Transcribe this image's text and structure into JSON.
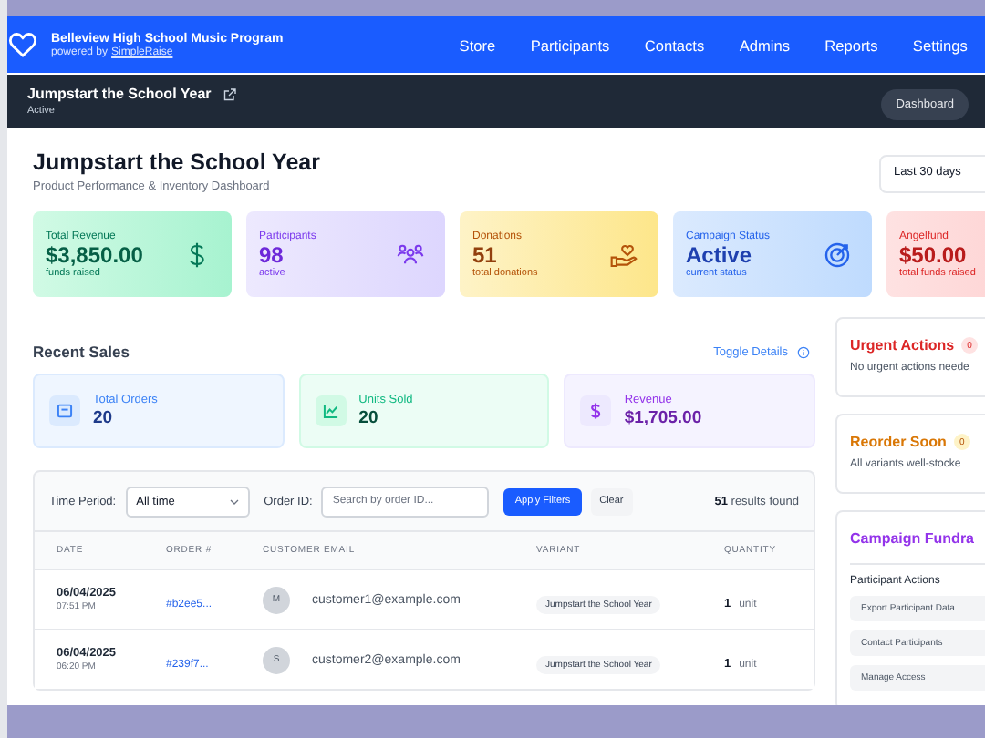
{
  "header": {
    "org": "Belleview High School Music Program",
    "powered_by": "powered by",
    "brand_link": "SimpleRaise",
    "nav": [
      "Store",
      "Participants",
      "Contacts",
      "Admins",
      "Reports",
      "Settings"
    ]
  },
  "campaign_bar": {
    "title": "Jumpstart the School Year",
    "status": "Active",
    "tabs": [
      {
        "label": "Dashboard",
        "selected": true
      }
    ]
  },
  "page": {
    "title": "Jumpstart the School Year",
    "subtitle": "Product Performance & Inventory Dashboard",
    "range_select": "Last 30 days"
  },
  "stats": [
    {
      "kind": "revenue",
      "label": "Total Revenue",
      "value": "$3,850.00",
      "caption": "funds raised"
    },
    {
      "kind": "participants",
      "label": "Participants",
      "value": "98",
      "caption": "active"
    },
    {
      "kind": "donations",
      "label": "Donations",
      "value": "51",
      "caption": "total donations"
    },
    {
      "kind": "status",
      "label": "Campaign Status",
      "value": "Active",
      "caption": "current status"
    },
    {
      "kind": "angelfund",
      "label": "Angelfund",
      "value": "$50.00",
      "caption": "total funds raised"
    }
  ],
  "recent_sales": {
    "title": "Recent Sales",
    "toggle_label": "Toggle Details",
    "summary": [
      {
        "kind": "orders",
        "label": "Total Orders",
        "value": "20"
      },
      {
        "kind": "units",
        "label": "Units Sold",
        "value": "20"
      },
      {
        "kind": "revenue",
        "label": "Revenue",
        "value": "$1,705.00"
      }
    ],
    "filters": {
      "time_period_label": "Time Period:",
      "time_period_value": "All time",
      "order_id_label": "Order ID:",
      "order_id_placeholder": "Search by order ID...",
      "apply_button": "Apply Filters",
      "clear_button": "Clear",
      "results_count": "51",
      "results_text": "results found"
    },
    "table": {
      "columns": [
        "DATE",
        "ORDER #",
        "CUSTOMER EMAIL",
        "VARIANT",
        "QUANTITY"
      ],
      "rows": [
        {
          "date": "06/04/2025",
          "time": "07:51 PM",
          "order": "#b2ee5...",
          "avatar": "M",
          "email": "customer1@example.com",
          "variant": "Jumpstart the School Year",
          "quantity": "1",
          "unit": "unit"
        },
        {
          "date": "06/04/2025",
          "time": "06:20 PM",
          "order": "#239f7...",
          "avatar": "S",
          "email": "customer2@example.com",
          "variant": "Jumpstart the School Year",
          "quantity": "1",
          "unit": "unit"
        }
      ]
    }
  },
  "side": {
    "urgent": {
      "title": "Urgent Actions",
      "count": "0",
      "message": "No urgent actions neede"
    },
    "reorder": {
      "title": "Reorder Soon",
      "count": "0",
      "message": "All variants well-stocke"
    },
    "fundraising": {
      "title": "Campaign Fundra",
      "section": "Participant Actions",
      "actions": [
        "Export Participant Data",
        "Contact Participants",
        "Manage Access"
      ]
    }
  }
}
